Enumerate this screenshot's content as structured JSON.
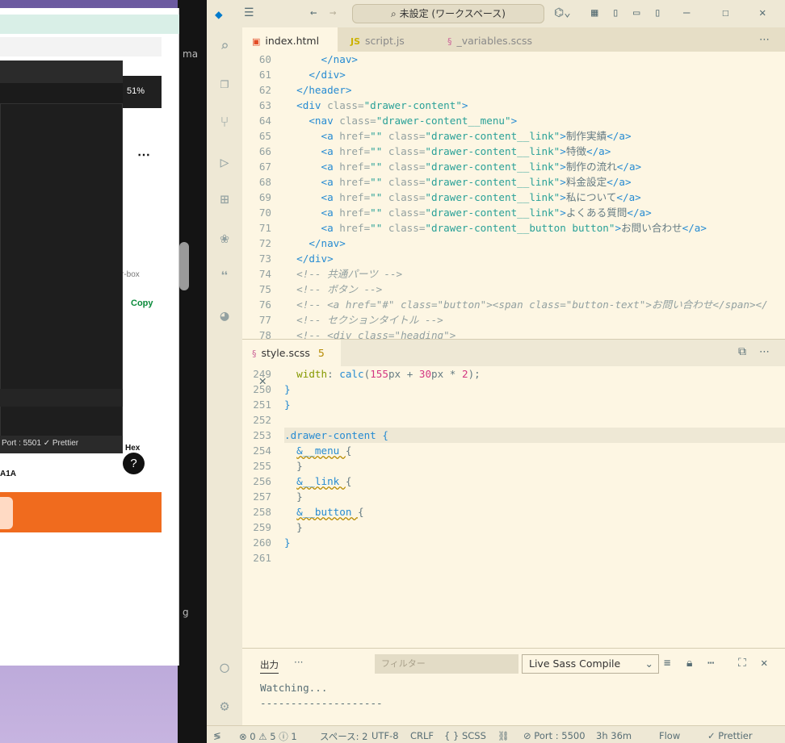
{
  "background": {
    "left_strip_text": "ma",
    "left_strip_text2": "g",
    "zoom": "51%",
    "copy_label": "Copy",
    "box_text": "r-box",
    "hex_label": "Hex",
    "a1a_text": "A1A",
    "help": "?",
    "inner_status": "Port : 5501  ✓ Prettier",
    "more": "⋯"
  },
  "titlebar": {
    "command_center": "未設定 (ワークスペース)"
  },
  "editor_tabs": [
    {
      "label": "index.html",
      "icon": "html5-icon"
    },
    {
      "label": "script.js",
      "icon": "js-icon"
    },
    {
      "label": "_variables.scss",
      "icon": "sass-icon"
    }
  ],
  "html_lines": [
    {
      "n": "60",
      "indent": "      ",
      "parts": [
        [
          "tag",
          "</nav>"
        ]
      ]
    },
    {
      "n": "61",
      "indent": "    ",
      "parts": [
        [
          "tag",
          "</div>"
        ]
      ]
    },
    {
      "n": "62",
      "indent": "  ",
      "parts": [
        [
          "tag",
          "</header>"
        ]
      ]
    },
    {
      "n": "63",
      "indent": "  ",
      "parts": [
        [
          "tag",
          "<div "
        ],
        [
          "attr",
          "class="
        ],
        [
          "val",
          "\"drawer-content\""
        ],
        [
          "tag",
          ">"
        ]
      ]
    },
    {
      "n": "64",
      "indent": "    ",
      "parts": [
        [
          "tag",
          "<nav "
        ],
        [
          "attr",
          "class="
        ],
        [
          "val",
          "\"drawer-content__menu\""
        ],
        [
          "tag",
          ">"
        ]
      ]
    },
    {
      "n": "65",
      "indent": "      ",
      "parts": [
        [
          "tag",
          "<a "
        ],
        [
          "attr",
          "href="
        ],
        [
          "val",
          "\"\" "
        ],
        [
          "attr",
          "class="
        ],
        [
          "val",
          "\"drawer-content__link\""
        ],
        [
          "tag",
          ">"
        ],
        [
          "txt",
          "制作実績"
        ],
        [
          "tag",
          "</a>"
        ]
      ]
    },
    {
      "n": "66",
      "indent": "      ",
      "parts": [
        [
          "tag",
          "<a "
        ],
        [
          "attr",
          "href="
        ],
        [
          "val",
          "\"\" "
        ],
        [
          "attr",
          "class="
        ],
        [
          "val",
          "\"drawer-content__link\""
        ],
        [
          "tag",
          ">"
        ],
        [
          "txt",
          "特徴"
        ],
        [
          "tag",
          "</a>"
        ]
      ]
    },
    {
      "n": "67",
      "indent": "      ",
      "parts": [
        [
          "tag",
          "<a "
        ],
        [
          "attr",
          "href="
        ],
        [
          "val",
          "\"\" "
        ],
        [
          "attr",
          "class="
        ],
        [
          "val",
          "\"drawer-content__link\""
        ],
        [
          "tag",
          ">"
        ],
        [
          "txt",
          "制作の流れ"
        ],
        [
          "tag",
          "</a>"
        ]
      ]
    },
    {
      "n": "68",
      "indent": "      ",
      "parts": [
        [
          "tag",
          "<a "
        ],
        [
          "attr",
          "href="
        ],
        [
          "val",
          "\"\" "
        ],
        [
          "attr",
          "class="
        ],
        [
          "val",
          "\"drawer-content__link\""
        ],
        [
          "tag",
          ">"
        ],
        [
          "txt",
          "料金設定"
        ],
        [
          "tag",
          "</a>"
        ]
      ]
    },
    {
      "n": "69",
      "indent": "      ",
      "parts": [
        [
          "tag",
          "<a "
        ],
        [
          "attr",
          "href="
        ],
        [
          "val",
          "\"\" "
        ],
        [
          "attr",
          "class="
        ],
        [
          "val",
          "\"drawer-content__link\""
        ],
        [
          "tag",
          ">"
        ],
        [
          "txt",
          "私について"
        ],
        [
          "tag",
          "</a>"
        ]
      ]
    },
    {
      "n": "70",
      "indent": "      ",
      "parts": [
        [
          "tag",
          "<a "
        ],
        [
          "attr",
          "href="
        ],
        [
          "val",
          "\"\" "
        ],
        [
          "attr",
          "class="
        ],
        [
          "val",
          "\"drawer-content__link\""
        ],
        [
          "tag",
          ">"
        ],
        [
          "txt",
          "よくある質問"
        ],
        [
          "tag",
          "</a>"
        ]
      ]
    },
    {
      "n": "71",
      "indent": "      ",
      "parts": [
        [
          "tag",
          "<a "
        ],
        [
          "attr",
          "href="
        ],
        [
          "val",
          "\"\" "
        ],
        [
          "attr",
          "class="
        ],
        [
          "val",
          "\"drawer-content__button button\""
        ],
        [
          "tag",
          ">"
        ],
        [
          "txt",
          "お問い合わせ"
        ],
        [
          "tag",
          "</a>"
        ]
      ]
    },
    {
      "n": "72",
      "indent": "    ",
      "parts": [
        [
          "tag",
          "</nav>"
        ]
      ]
    },
    {
      "n": "73",
      "indent": "  ",
      "parts": [
        [
          "tag",
          "</div>"
        ]
      ]
    },
    {
      "n": "74",
      "indent": "  ",
      "parts": [
        [
          "cmt",
          "<!-- 共通パーツ -->"
        ]
      ]
    },
    {
      "n": "75",
      "indent": "  ",
      "parts": [
        [
          "cmt",
          "<!-- ボタン -->"
        ]
      ]
    },
    {
      "n": "76",
      "indent": "  ",
      "parts": [
        [
          "cmt",
          "<!-- <a href=\"#\" class=\"button\"><span class=\"button-text\">お問い合わせ</span></"
        ]
      ]
    },
    {
      "n": "77",
      "indent": "  ",
      "parts": [
        [
          "cmt",
          "<!-- セクションタイトル -->"
        ]
      ]
    },
    {
      "n": "78",
      "indent": "  ",
      "parts": [
        [
          "cmt",
          "<!-- <div class=\"heading\">"
        ]
      ]
    }
  ],
  "scss_tab": {
    "label": "style.scss",
    "badge": "5"
  },
  "scss_lines": [
    {
      "n": "249",
      "indent": "  ",
      "parts": [
        [
          "prop",
          "width"
        ],
        [
          "txt",
          ": "
        ],
        [
          "tag",
          "calc"
        ],
        [
          "txt",
          "("
        ],
        [
          "num",
          "155"
        ],
        [
          "txt",
          "px + "
        ],
        [
          "num",
          "30"
        ],
        [
          "txt",
          "px * "
        ],
        [
          "num",
          "2"
        ],
        [
          "txt",
          ");"
        ]
      ]
    },
    {
      "n": "250",
      "indent": "",
      "parts": [
        [
          "tag",
          "}"
        ]
      ]
    },
    {
      "n": "251",
      "indent": "",
      "parts": [
        [
          "tag",
          "}"
        ]
      ]
    },
    {
      "n": "252",
      "indent": "",
      "parts": []
    },
    {
      "n": "253",
      "indent": "",
      "parts": [
        [
          "sel",
          ".drawer-content "
        ],
        [
          "tag",
          "{"
        ]
      ]
    },
    {
      "n": "254",
      "indent": "  ",
      "parts": [
        [
          "sel",
          "&__menu "
        ],
        [
          "txt",
          "{"
        ]
      ]
    },
    {
      "n": "255",
      "indent": "  ",
      "parts": [
        [
          "txt",
          "}"
        ]
      ]
    },
    {
      "n": "256",
      "indent": "  ",
      "parts": [
        [
          "sel",
          "&__link "
        ],
        [
          "txt",
          "{"
        ]
      ]
    },
    {
      "n": "257",
      "indent": "  ",
      "parts": [
        [
          "txt",
          "}"
        ]
      ]
    },
    {
      "n": "258",
      "indent": "  ",
      "parts": [
        [
          "sel",
          "&__button "
        ],
        [
          "txt",
          "{"
        ]
      ]
    },
    {
      "n": "259",
      "indent": "  ",
      "parts": [
        [
          "txt",
          "}"
        ]
      ]
    },
    {
      "n": "260",
      "indent": "",
      "parts": [
        [
          "tag",
          "}"
        ]
      ]
    },
    {
      "n": "261",
      "indent": "",
      "parts": []
    }
  ],
  "panel": {
    "tab_output": "出力",
    "more": "···",
    "filter_placeholder": "フィルター",
    "select_value": "Live Sass Compile",
    "output_lines": [
      "Watching...",
      "--------------------"
    ]
  },
  "statusbar": {
    "remote": "≶",
    "problems": "⊗ 0 ⚠ 5 ⓘ 1",
    "spaces": "スペース: 2",
    "encoding": "UTF-8",
    "eol": "CRLF",
    "language": "{ } SCSS",
    "port": "⊘ Port : 5500",
    "time": "3h 36m",
    "flow": "Flow",
    "prettier": "✓ Prettier"
  }
}
